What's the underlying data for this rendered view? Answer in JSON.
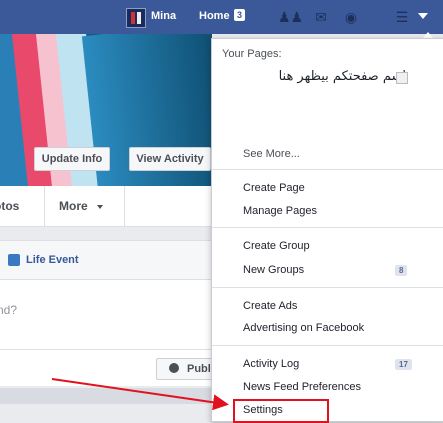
{
  "topbar": {
    "user_name": "Mina",
    "home_label": "Home",
    "home_count": "3",
    "icons": [
      "friend-requests-icon",
      "messages-icon",
      "notifications-globe-icon",
      "settings-icon",
      "menu-caret-icon"
    ]
  },
  "profile": {
    "update_info_label": "Update Info",
    "view_activity_label": "View Activity",
    "nav_photos": "otos",
    "nav_more": "More"
  },
  "composer": {
    "life_event_label": "Life Event",
    "input_fragment": "nd?",
    "publish_label": "Publ"
  },
  "menu": {
    "your_pages_label": "Your Pages:",
    "page_name": "اسم صفحتكم بيظهر هنا",
    "see_more": "See More...",
    "create_page": "Create Page",
    "manage_pages": "Manage Pages",
    "create_group": "Create Group",
    "new_groups": "New Groups",
    "new_groups_badge": "8",
    "create_ads": "Create Ads",
    "advertising": "Advertising on Facebook",
    "activity_log": "Activity Log",
    "activity_log_badge": "17",
    "news_feed_prefs": "News Feed Preferences",
    "settings": "Settings"
  },
  "colors": {
    "facebook_blue": "#3b5998",
    "highlight_red": "#e2111f"
  }
}
